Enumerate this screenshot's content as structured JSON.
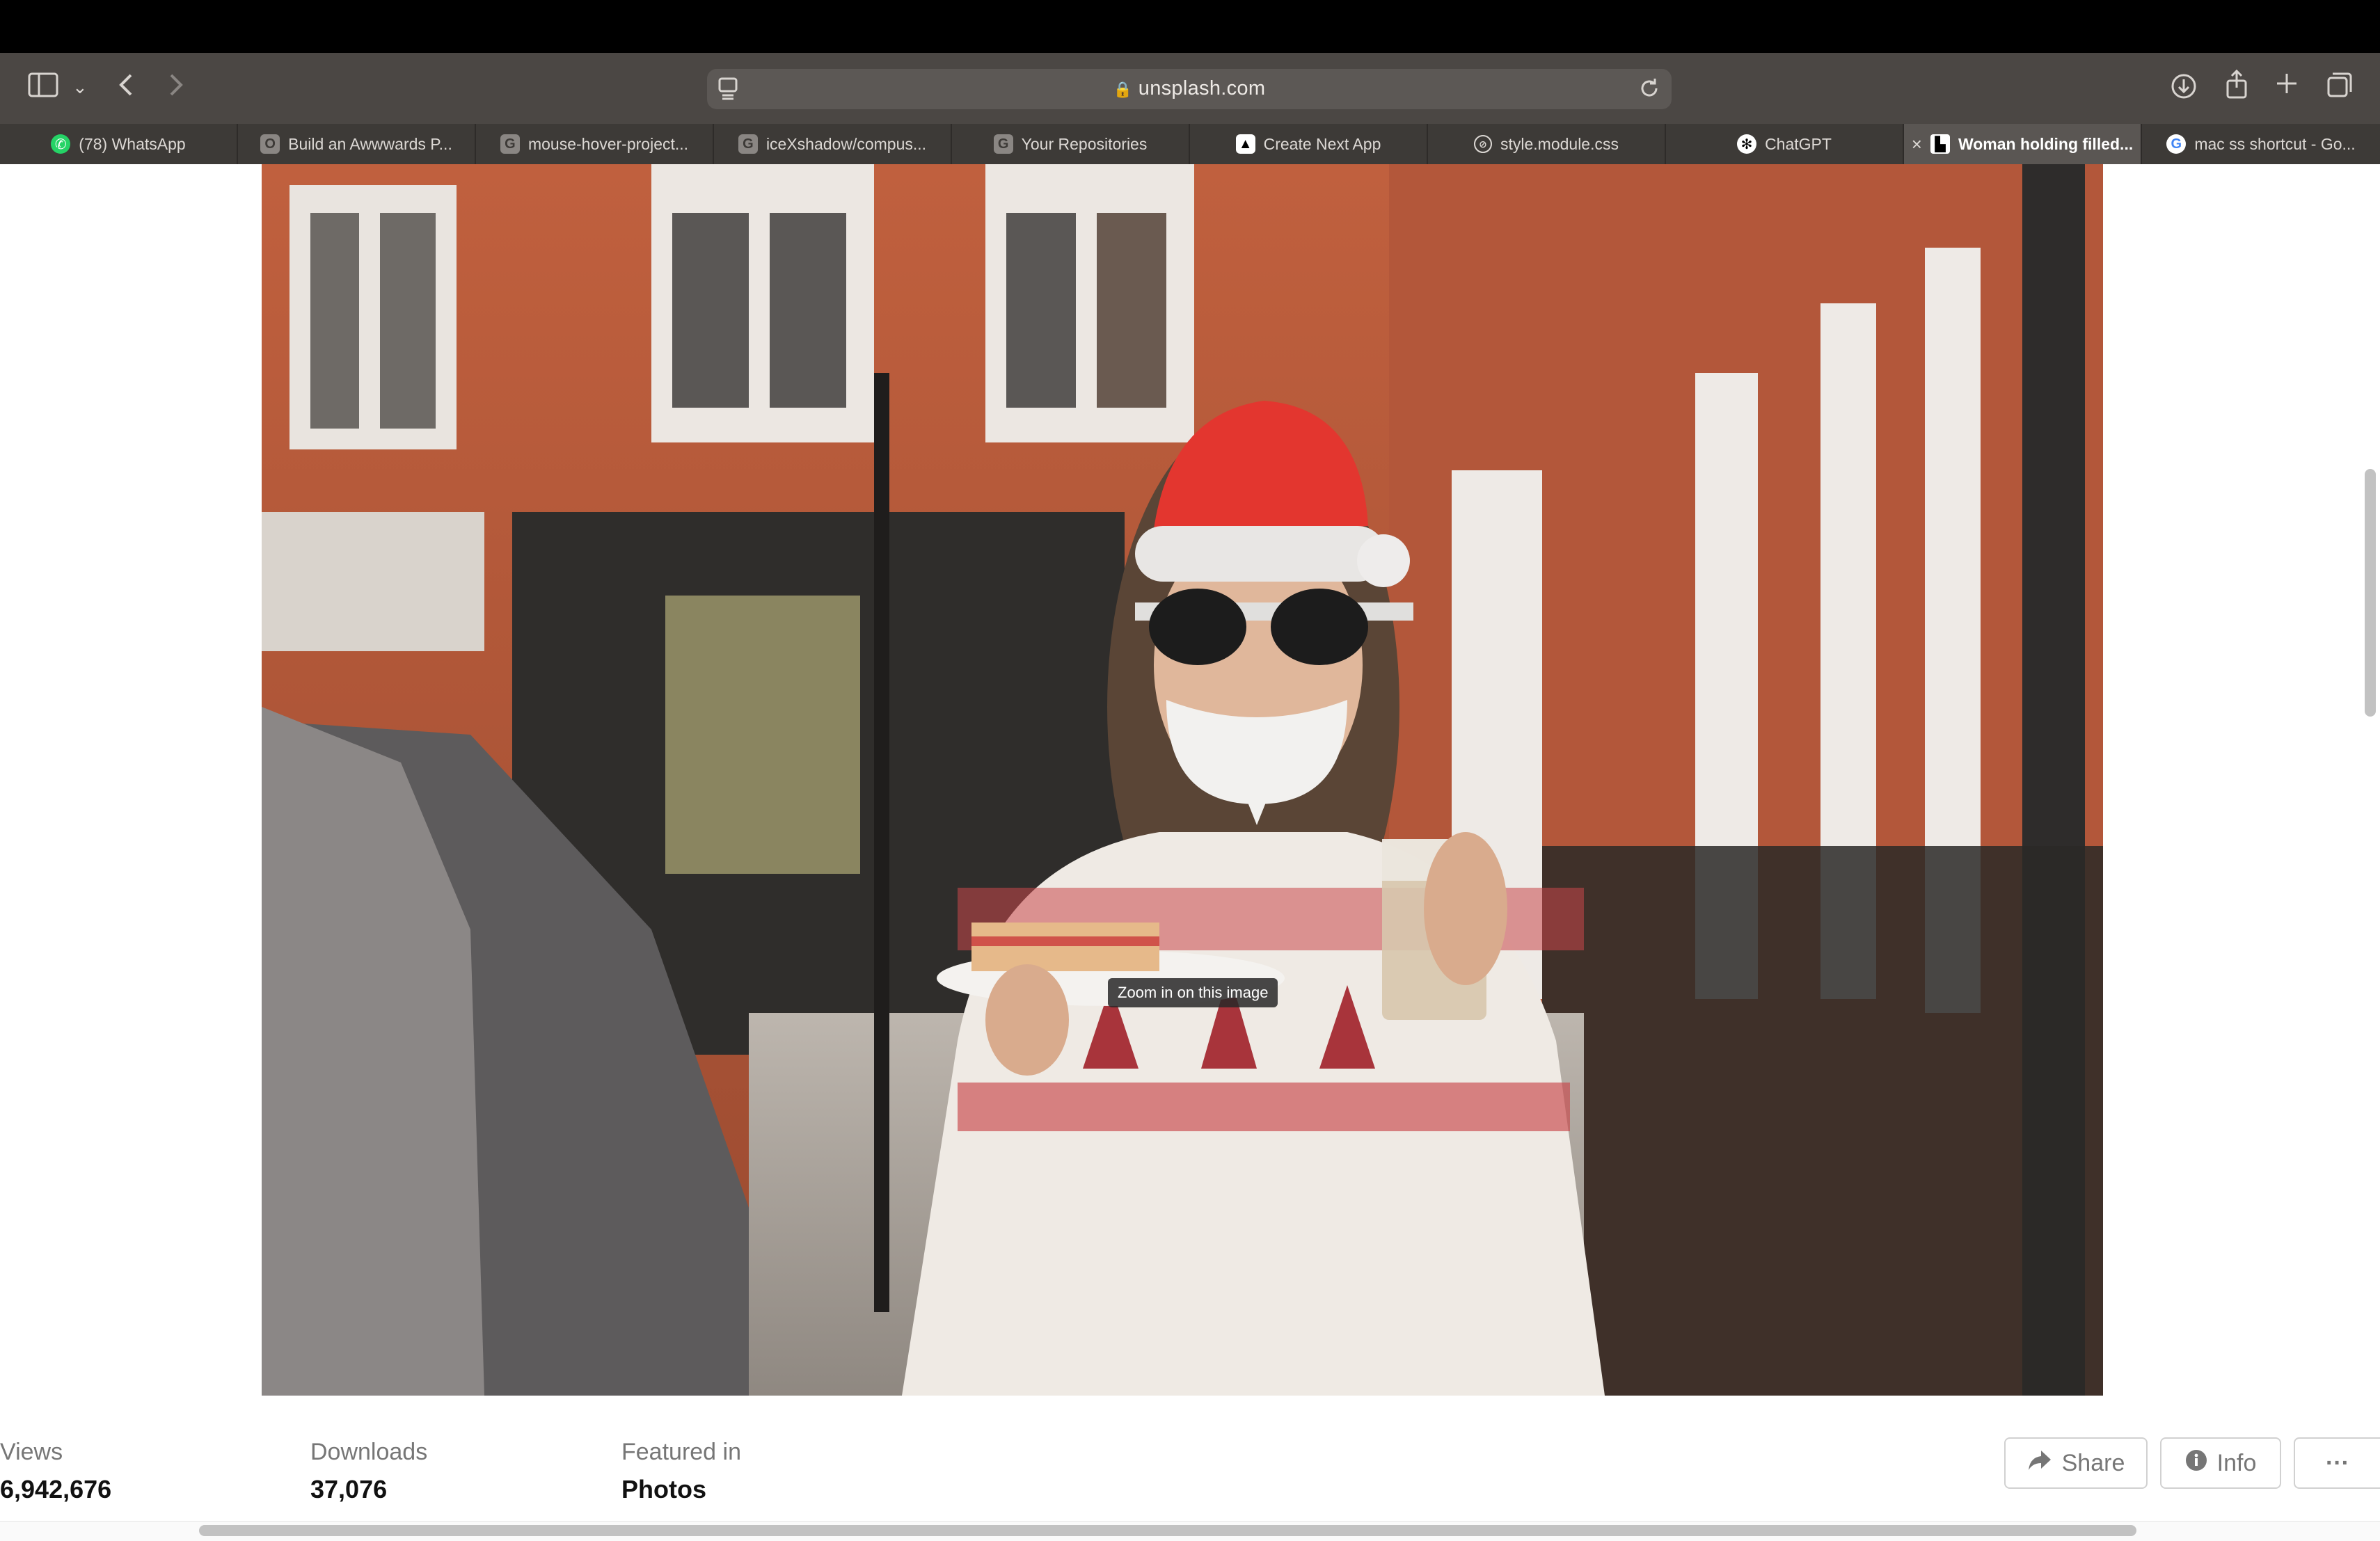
{
  "browser": {
    "url": "unsplash.com",
    "tabs": [
      {
        "label": "(78) WhatsApp",
        "favicon": "whatsapp-icon"
      },
      {
        "label": "Build an Awwwards P...",
        "favicon": "o-icon"
      },
      {
        "label": "mouse-hover-project...",
        "favicon": "g-icon"
      },
      {
        "label": "iceXshadow/compus...",
        "favicon": "g-icon"
      },
      {
        "label": "Your Repositories",
        "favicon": "g-icon"
      },
      {
        "label": "Create Next App",
        "favicon": "triangle-icon"
      },
      {
        "label": "style.module.css",
        "favicon": "compass-icon"
      },
      {
        "label": "ChatGPT",
        "favicon": "chatgpt-icon"
      },
      {
        "label": "Woman holding filled...",
        "favicon": "unsplash-icon",
        "active": true
      },
      {
        "label": "mac ss shortcut - Go...",
        "favicon": "google-icon"
      }
    ]
  },
  "photo": {
    "tooltip": "Zoom in on this image"
  },
  "stats": {
    "views_label": "Views",
    "views_value": "6,942,676",
    "downloads_label": "Downloads",
    "downloads_value": "37,076",
    "featured_label": "Featured in",
    "featured_value": "Photos"
  },
  "actions": {
    "share_label": "Share",
    "info_label": "Info",
    "more_label": "···"
  },
  "colors": {
    "toolbar": "#4b4744",
    "tabstrip": "#3d3a37",
    "active_tab": "#5a5653",
    "stat_label": "#767676",
    "stat_value": "#111111"
  }
}
